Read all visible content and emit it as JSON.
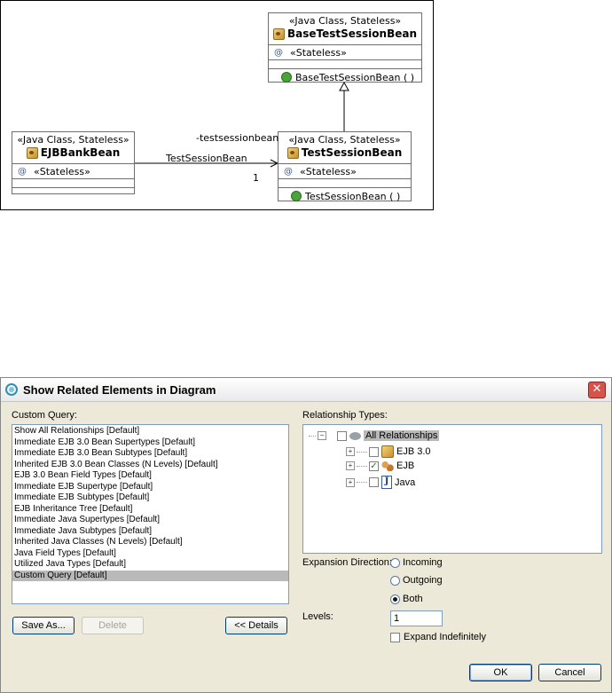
{
  "diagram": {
    "base": {
      "stereotype": "«Java Class, Stateless»",
      "name": "BaseTestSessionBean",
      "annotation": "«Stateless»",
      "method": "BaseTestSessionBean ( )"
    },
    "test": {
      "stereotype": "«Java Class, Stateless»",
      "name": "TestSessionBean",
      "annotation": "«Stateless»",
      "method": "TestSessionBean ( )"
    },
    "bank": {
      "stereotype": "«Java Class, Stateless»",
      "name": "EJBBankBean",
      "annotation": "«Stateless»"
    },
    "assoc_role": "-testsessionbean",
    "assoc_name": "TestSessionBean",
    "multiplicity": "1",
    "at_symbol": "@"
  },
  "dialog": {
    "title": "Show Related Elements in Diagram",
    "close": "✕",
    "custom_query_label": "Custom Query:",
    "queries": [
      "Show All Relationships [Default]",
      "Immediate EJB 3.0 Bean Supertypes [Default]",
      "Immediate EJB 3.0 Bean Subtypes [Default]",
      "Inherited EJB 3.0 Bean Classes (N Levels) [Default]",
      "EJB 3.0 Bean Field Types [Default]",
      "Immediate EJB Supertype [Default]",
      "Immediate EJB Subtypes [Default]",
      "EJB Inheritance Tree [Default]",
      "Immediate Java Supertypes [Default]",
      "Immediate Java Subtypes [Default]",
      "Inherited Java Classes (N Levels) [Default]",
      "Java Field Types [Default]",
      "Utilized Java Types [Default]",
      "Custom Query [Default]"
    ],
    "selected_query": "Custom Query [Default]",
    "relationship_types_label": "Relationship Types:",
    "tree": {
      "root": "All Relationships",
      "children": [
        "EJB 3.0",
        "EJB",
        "Java"
      ]
    },
    "expansion_label": "Expansion Direction:",
    "incoming": "Incoming",
    "outgoing": "Outgoing",
    "both": "Both",
    "levels_label": "Levels:",
    "levels_value": "1",
    "expand_indefinitely": "Expand Indefinitely",
    "save_as": "Save As...",
    "delete": "Delete",
    "details": "<< Details",
    "ok": "OK",
    "cancel": "Cancel"
  }
}
